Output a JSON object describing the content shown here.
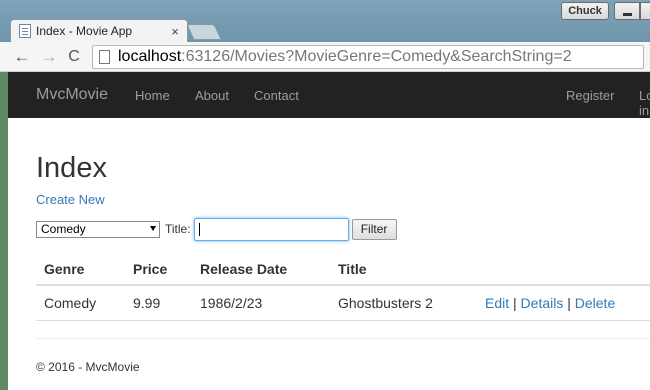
{
  "browser": {
    "tab_title": "Index - Movie App",
    "tab_close": "×",
    "user_button": "Chuck",
    "url_host": "localhost",
    "url_rest": ":63126/Movies?MovieGenre=Comedy&SearchString=2",
    "back": "←",
    "forward": "→",
    "reload": "C"
  },
  "navbar": {
    "brand": "MvcMovie",
    "links": [
      "Home",
      "About",
      "Contact"
    ],
    "right_links": [
      "Register",
      "Log in"
    ]
  },
  "page": {
    "title": "Index",
    "create_new": "Create New"
  },
  "filter": {
    "genre_selected": "Comedy",
    "title_label": "Title:",
    "search_value": "",
    "button_label": "Filter"
  },
  "table": {
    "headers": [
      "Genre",
      "Price",
      "Release Date",
      "Title"
    ],
    "rows": [
      {
        "genre": "Comedy",
        "price": "9.99",
        "release_date": "1986/2/23",
        "title": "Ghostbusters 2",
        "edit": "Edit",
        "details": "Details",
        "delete": "Delete"
      }
    ]
  },
  "footer": {
    "text": "© 2016 - MvcMovie"
  }
}
